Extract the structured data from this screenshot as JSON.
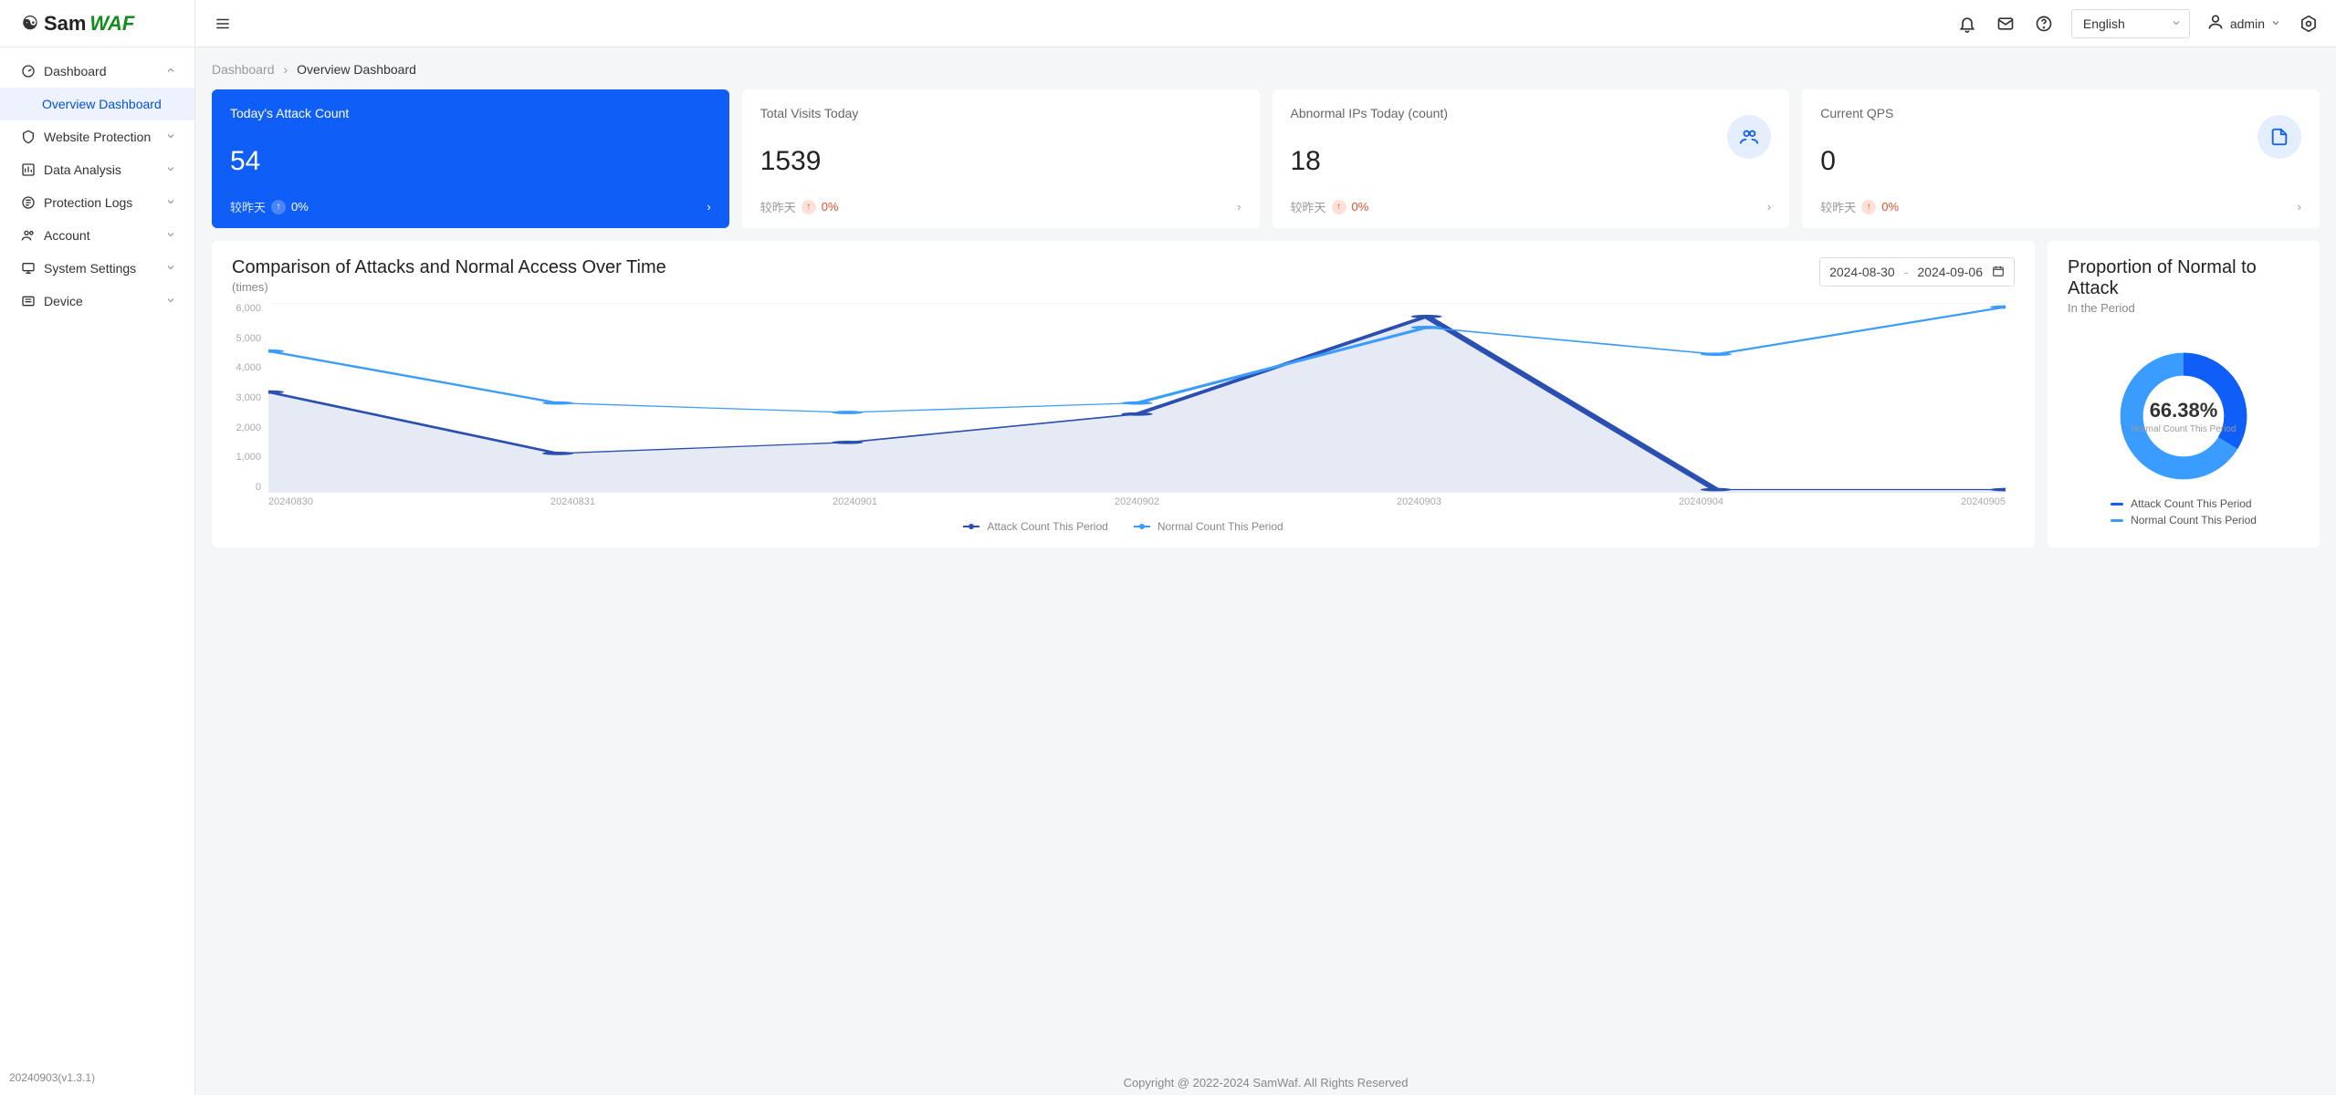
{
  "brand": {
    "sam": "Sam",
    "waf": "WAF"
  },
  "version": "20240903(v1.3.1)",
  "topbar": {
    "language": "English",
    "user": "admin"
  },
  "breadcrumb": {
    "root": "Dashboard",
    "current": "Overview Dashboard"
  },
  "sidebar": {
    "items": [
      {
        "label": "Dashboard",
        "expanded": true
      },
      {
        "label": "Website Protection"
      },
      {
        "label": "Data Analysis"
      },
      {
        "label": "Protection Logs"
      },
      {
        "label": "Account"
      },
      {
        "label": "System Settings"
      },
      {
        "label": "Device"
      }
    ],
    "sub": "Overview Dashboard"
  },
  "cards": {
    "compare_label": "较昨天",
    "attack": {
      "title": "Today's Attack Count",
      "value": "54",
      "pct": "0%"
    },
    "visits": {
      "title": "Total Visits Today",
      "value": "1539",
      "pct": "0%"
    },
    "abnormal": {
      "title": "Abnormal IPs Today (count)",
      "value": "18",
      "pct": "0%"
    },
    "qps": {
      "title": "Current QPS",
      "value": "0",
      "pct": "0%"
    }
  },
  "chart": {
    "title": "Comparison of Attacks and Normal Access Over Time",
    "subtitle": "(times)",
    "date_from": "2024-08-30",
    "date_to": "2024-09-06",
    "legend_attack": "Attack Count This Period",
    "legend_normal": "Normal Count This Period",
    "y_ticks": [
      "6,000",
      "5,000",
      "4,000",
      "3,000",
      "2,000",
      "1,000",
      "0"
    ]
  },
  "donut": {
    "title": "Proportion of Normal to Attack",
    "subtitle": "In the Period",
    "percent": "66.38%",
    "center_label": "Normal Count This Period",
    "legend_attack": "Attack Count This Period",
    "legend_normal": "Normal Count This Period"
  },
  "footer": "Copyright @ 2022-2024 SamWaf. All Rights Reserved",
  "chart_data": {
    "type": "line",
    "x": [
      "20240830",
      "20240831",
      "20240901",
      "20240902",
      "20240903",
      "20240904",
      "20240905"
    ],
    "ylim": [
      0,
      6000
    ],
    "series": [
      {
        "name": "Attack Count This Period",
        "color": "#2a4fb0",
        "values": [
          3200,
          1250,
          1600,
          2500,
          5600,
          100,
          100
        ]
      },
      {
        "name": "Normal Count This Period",
        "color": "#3b9cff",
        "values": [
          4500,
          2850,
          2550,
          2850,
          5250,
          4400,
          5900
        ]
      }
    ],
    "donut": {
      "normal_pct": 66.38,
      "attack_pct": 33.62
    }
  }
}
